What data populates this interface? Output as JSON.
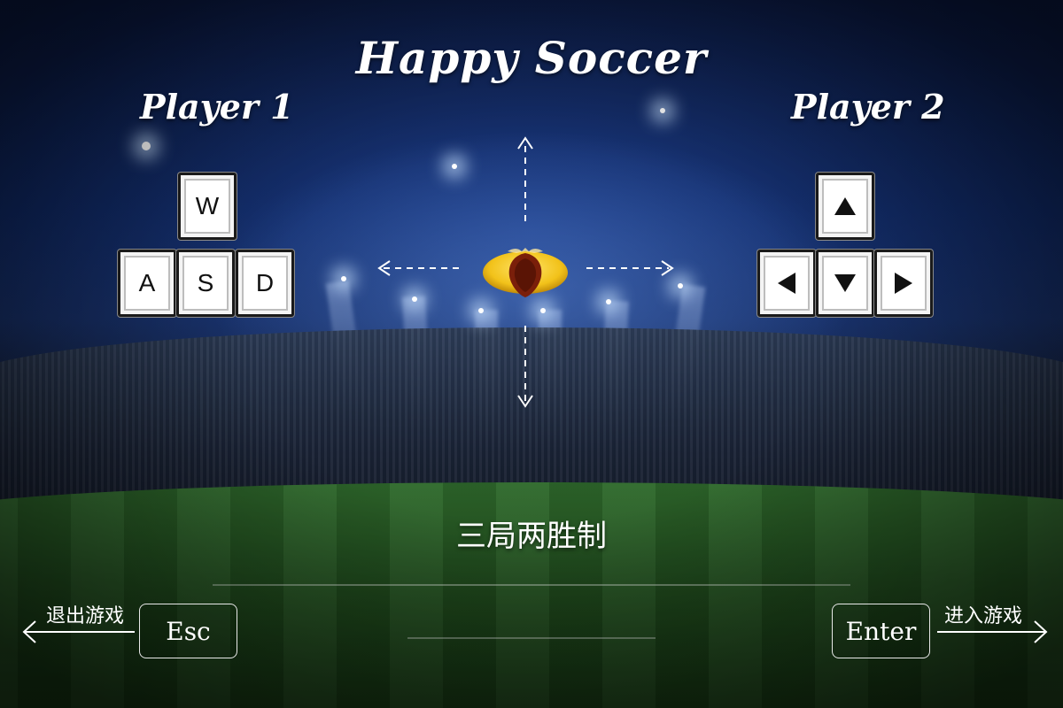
{
  "title": "Happy Soccer",
  "player1": {
    "label": "Player 1",
    "keys": {
      "up": "W",
      "left": "A",
      "down": "S",
      "right": "D"
    }
  },
  "player2": {
    "label": "Player 2",
    "keys": {
      "up": "up-arrow-icon",
      "left": "left-arrow-icon",
      "down": "down-arrow-icon",
      "right": "right-arrow-icon"
    }
  },
  "center_icon": "soccer-ball-icon",
  "rule_text": "三局两胜制",
  "exit": {
    "label": "退出游戏",
    "key": "Esc"
  },
  "enter": {
    "label": "进入游戏",
    "key": "Enter"
  },
  "colors": {
    "text": "#ffffff",
    "key_face": "#ffffff",
    "key_border": "#1a1a1a",
    "ball_gold": "#f2c21a",
    "ball_core": "#6b1a08"
  }
}
